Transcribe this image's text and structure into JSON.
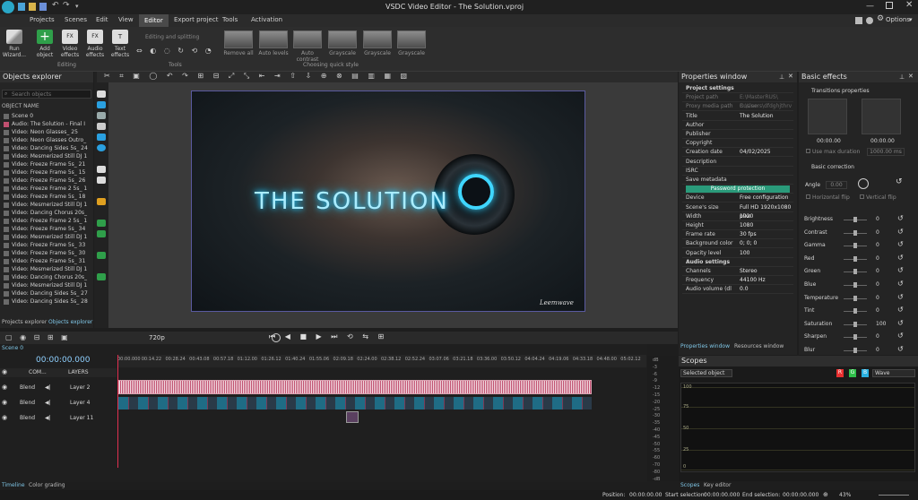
{
  "window": {
    "title": "VSDC Video Editor - The Solution.vproj",
    "options_label": "Options"
  },
  "menu": [
    "Projects",
    "Scenes",
    "Edit",
    "View",
    "Editor",
    "Export project",
    "Tools",
    "Activation"
  ],
  "ribbon": {
    "run_wizard": "Run\nWizard...",
    "add_object": "Add\nobject",
    "video_effects": "Video\neffects",
    "audio_effects": "Audio\neffects",
    "text_effects": "Text\neffects",
    "group_editing": "Editing",
    "editing_splitting": "Editing and splitting",
    "group_tools": "Tools",
    "quick_styles": [
      "Remove all",
      "Auto levels",
      "Auto contrast",
      "Grayscale",
      "Grayscale",
      "Grayscale"
    ],
    "group_quick_style": "Choosing quick style"
  },
  "objects_explorer": {
    "title": "Objects explorer",
    "search_placeholder": "Search objects",
    "col_header": "OBJECT NAME",
    "items": [
      "Scene 0",
      "Audio: The Solution - Final I",
      "Video: Neon Glasses_ 25",
      "Video: Neon Glasses Outro_",
      "Video: Dancing Sides 5s_ 24",
      "Video: Mesmerized Still DJ 1",
      "Video: Freeze Frame 5s_ 21",
      "Video: Freeze Frame 5s_ 15",
      "Video: Freeze Frame 5s_ 26",
      "Video: Freeze Frame 2 5s_ 1",
      "Video: Freeze Frame 5s_ 18",
      "Video: Mesmerized Still DJ 1",
      "Video: Dancing Chorus 20s_",
      "Video: Freeze Frame 2 5s_ 1",
      "Video: Freeze Frame 5s_ 34",
      "Video: Mesmerized Still DJ 1",
      "Video: Freeze Frame 5s_ 33",
      "Video: Freeze Frame 5s_ 30",
      "Video: Freeze Frame 5s_ 31",
      "Video: Mesmerized Still DJ 1",
      "Video: Dancing Chorus 20s_",
      "Video: Mesmerized Still DJ 1",
      "Video: Dancing Sides 5s_ 27",
      "Video: Dancing Sides 5s_ 28"
    ],
    "tabs": [
      "Projects explorer",
      "Objects explorer"
    ]
  },
  "preview": {
    "title_text": "THE SOLUTION",
    "watermark": "Leemwave",
    "quality": "720p"
  },
  "properties": {
    "title": "Properties window",
    "rows": [
      {
        "k": "Project settings",
        "v": "",
        "sec": true
      },
      {
        "k": "Project path",
        "v": "E:\\MasterRUS\\ Busine",
        "dim": true
      },
      {
        "k": "Proxy media path",
        "v": "C:\\Users\\dfdghjthrv",
        "dim": true
      },
      {
        "k": "Title",
        "v": "The Solution"
      },
      {
        "k": "Author",
        "v": ""
      },
      {
        "k": "Publisher",
        "v": ""
      },
      {
        "k": "Copyright",
        "v": ""
      },
      {
        "k": "Creation date",
        "v": "04/02/2025"
      },
      {
        "k": "Description",
        "v": ""
      },
      {
        "k": "ISRC",
        "v": ""
      },
      {
        "k": "Save metadata",
        "v": ""
      },
      {
        "k": "",
        "v": "Password protection",
        "btn": true
      },
      {
        "k": "Device",
        "v": "Free configuration"
      },
      {
        "k": "Scene's size",
        "v": "Full HD 1920x1080 pixe"
      },
      {
        "k": "  Width",
        "v": "1920"
      },
      {
        "k": "  Height",
        "v": "1080"
      },
      {
        "k": "Frame rate",
        "v": "30 fps"
      },
      {
        "k": "Background color",
        "v": "0; 0; 0"
      },
      {
        "k": "  Opacity level",
        "v": "100"
      },
      {
        "k": "Audio settings",
        "v": "",
        "sec": true
      },
      {
        "k": "  Channels",
        "v": "Stereo"
      },
      {
        "k": "  Frequency",
        "v": "44100 Hz"
      },
      {
        "k": "  Audio volume (dl",
        "v": "0.0"
      }
    ],
    "tabs": [
      "Properties window",
      "Resources window"
    ]
  },
  "basic_effects": {
    "title": "Basic effects",
    "transitions": "Transitions properties",
    "t1": "00:00.00",
    "t2": "00:00.00",
    "use_max": "Use max duration",
    "dur": "1000.00 ms",
    "correction": "Basic correction",
    "angle_label": "Angle",
    "angle_val": "0.00",
    "hflip": "Horizontal flip",
    "vflip": "Vertical flip",
    "sliders": [
      {
        "n": "Brightness",
        "v": "0",
        "p": 0.5
      },
      {
        "n": "Contrast",
        "v": "0",
        "p": 0.5
      },
      {
        "n": "Gamma",
        "v": "0",
        "p": 0.5
      },
      {
        "n": "Red",
        "v": "0",
        "p": 0.5
      },
      {
        "n": "Green",
        "v": "0",
        "p": 0.5
      },
      {
        "n": "Blue",
        "v": "0",
        "p": 0.5
      },
      {
        "n": "Temperature",
        "v": "0",
        "p": 0.5
      },
      {
        "n": "Tint",
        "v": "0",
        "p": 0.5
      },
      {
        "n": "Saturation",
        "v": "100",
        "p": 0.5
      },
      {
        "n": "Sharpen",
        "v": "0",
        "p": 0.5
      },
      {
        "n": "Blur",
        "v": "0",
        "p": 0.5
      }
    ]
  },
  "scopes": {
    "title": "Scopes",
    "selected": "Selected object",
    "mode": "Wave",
    "r": "R",
    "g": "G",
    "b": "B",
    "ticks": [
      "100",
      "75",
      "50",
      "25",
      "0"
    ],
    "tabs": [
      "Scopes",
      "Key editor"
    ]
  },
  "timeline": {
    "scene_tab": "Scene 0",
    "time": "00:00:00.000",
    "ruler": [
      "00:00.000",
      "00:14.22",
      "00:28.24",
      "00:43.08",
      "00:57.18",
      "01:12.00",
      "01:26.12",
      "01:40.24",
      "01:55.06",
      "02:09.18",
      "02:24.00",
      "02:38.12",
      "02:52.24",
      "03:07.06",
      "03:21.18",
      "03:36.00",
      "03:50.12",
      "04:04.24",
      "04:19.06",
      "04:33.18",
      "04:48.00",
      "05:02.12"
    ],
    "header": [
      "COM...",
      "LAYERS"
    ],
    "tracks": [
      {
        "blend": "Blend",
        "name": "Layer 2"
      },
      {
        "blend": "Blend",
        "name": "Layer 4"
      },
      {
        "blend": "Blend",
        "name": "Layer 11"
      }
    ],
    "tabs": [
      "Timeline",
      "Color grading"
    ],
    "db": [
      "dB",
      "-3",
      "-6",
      "-9",
      "-12",
      "-15",
      "-20",
      "-25",
      "-30",
      "-35",
      "-40",
      "-45",
      "-50",
      "-55",
      "-60",
      "-70",
      "-80",
      "-dB"
    ]
  },
  "status": {
    "position_label": "Position:",
    "position": "00:00:00.00",
    "start_label": "Start selection:",
    "start": "00:00:00.000",
    "end_label": "End selection:",
    "end": "00:00:00.000",
    "zoom": "43%"
  }
}
